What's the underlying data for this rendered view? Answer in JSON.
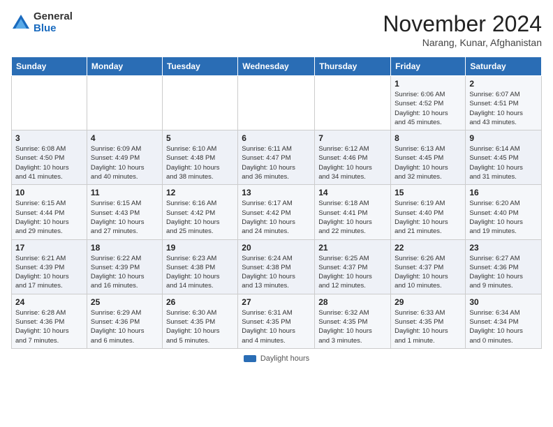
{
  "logo": {
    "general": "General",
    "blue": "Blue"
  },
  "title": "November 2024",
  "location": "Narang, Kunar, Afghanistan",
  "weekdays": [
    "Sunday",
    "Monday",
    "Tuesday",
    "Wednesday",
    "Thursday",
    "Friday",
    "Saturday"
  ],
  "weeks": [
    [
      {
        "day": "",
        "info": ""
      },
      {
        "day": "",
        "info": ""
      },
      {
        "day": "",
        "info": ""
      },
      {
        "day": "",
        "info": ""
      },
      {
        "day": "",
        "info": ""
      },
      {
        "day": "1",
        "info": "Sunrise: 6:06 AM\nSunset: 4:52 PM\nDaylight: 10 hours\nand 45 minutes."
      },
      {
        "day": "2",
        "info": "Sunrise: 6:07 AM\nSunset: 4:51 PM\nDaylight: 10 hours\nand 43 minutes."
      }
    ],
    [
      {
        "day": "3",
        "info": "Sunrise: 6:08 AM\nSunset: 4:50 PM\nDaylight: 10 hours\nand 41 minutes."
      },
      {
        "day": "4",
        "info": "Sunrise: 6:09 AM\nSunset: 4:49 PM\nDaylight: 10 hours\nand 40 minutes."
      },
      {
        "day": "5",
        "info": "Sunrise: 6:10 AM\nSunset: 4:48 PM\nDaylight: 10 hours\nand 38 minutes."
      },
      {
        "day": "6",
        "info": "Sunrise: 6:11 AM\nSunset: 4:47 PM\nDaylight: 10 hours\nand 36 minutes."
      },
      {
        "day": "7",
        "info": "Sunrise: 6:12 AM\nSunset: 4:46 PM\nDaylight: 10 hours\nand 34 minutes."
      },
      {
        "day": "8",
        "info": "Sunrise: 6:13 AM\nSunset: 4:45 PM\nDaylight: 10 hours\nand 32 minutes."
      },
      {
        "day": "9",
        "info": "Sunrise: 6:14 AM\nSunset: 4:45 PM\nDaylight: 10 hours\nand 31 minutes."
      }
    ],
    [
      {
        "day": "10",
        "info": "Sunrise: 6:15 AM\nSunset: 4:44 PM\nDaylight: 10 hours\nand 29 minutes."
      },
      {
        "day": "11",
        "info": "Sunrise: 6:15 AM\nSunset: 4:43 PM\nDaylight: 10 hours\nand 27 minutes."
      },
      {
        "day": "12",
        "info": "Sunrise: 6:16 AM\nSunset: 4:42 PM\nDaylight: 10 hours\nand 25 minutes."
      },
      {
        "day": "13",
        "info": "Sunrise: 6:17 AM\nSunset: 4:42 PM\nDaylight: 10 hours\nand 24 minutes."
      },
      {
        "day": "14",
        "info": "Sunrise: 6:18 AM\nSunset: 4:41 PM\nDaylight: 10 hours\nand 22 minutes."
      },
      {
        "day": "15",
        "info": "Sunrise: 6:19 AM\nSunset: 4:40 PM\nDaylight: 10 hours\nand 21 minutes."
      },
      {
        "day": "16",
        "info": "Sunrise: 6:20 AM\nSunset: 4:40 PM\nDaylight: 10 hours\nand 19 minutes."
      }
    ],
    [
      {
        "day": "17",
        "info": "Sunrise: 6:21 AM\nSunset: 4:39 PM\nDaylight: 10 hours\nand 17 minutes."
      },
      {
        "day": "18",
        "info": "Sunrise: 6:22 AM\nSunset: 4:39 PM\nDaylight: 10 hours\nand 16 minutes."
      },
      {
        "day": "19",
        "info": "Sunrise: 6:23 AM\nSunset: 4:38 PM\nDaylight: 10 hours\nand 14 minutes."
      },
      {
        "day": "20",
        "info": "Sunrise: 6:24 AM\nSunset: 4:38 PM\nDaylight: 10 hours\nand 13 minutes."
      },
      {
        "day": "21",
        "info": "Sunrise: 6:25 AM\nSunset: 4:37 PM\nDaylight: 10 hours\nand 12 minutes."
      },
      {
        "day": "22",
        "info": "Sunrise: 6:26 AM\nSunset: 4:37 PM\nDaylight: 10 hours\nand 10 minutes."
      },
      {
        "day": "23",
        "info": "Sunrise: 6:27 AM\nSunset: 4:36 PM\nDaylight: 10 hours\nand 9 minutes."
      }
    ],
    [
      {
        "day": "24",
        "info": "Sunrise: 6:28 AM\nSunset: 4:36 PM\nDaylight: 10 hours\nand 7 minutes."
      },
      {
        "day": "25",
        "info": "Sunrise: 6:29 AM\nSunset: 4:36 PM\nDaylight: 10 hours\nand 6 minutes."
      },
      {
        "day": "26",
        "info": "Sunrise: 6:30 AM\nSunset: 4:35 PM\nDaylight: 10 hours\nand 5 minutes."
      },
      {
        "day": "27",
        "info": "Sunrise: 6:31 AM\nSunset: 4:35 PM\nDaylight: 10 hours\nand 4 minutes."
      },
      {
        "day": "28",
        "info": "Sunrise: 6:32 AM\nSunset: 4:35 PM\nDaylight: 10 hours\nand 3 minutes."
      },
      {
        "day": "29",
        "info": "Sunrise: 6:33 AM\nSunset: 4:35 PM\nDaylight: 10 hours\nand 1 minute."
      },
      {
        "day": "30",
        "info": "Sunrise: 6:34 AM\nSunset: 4:34 PM\nDaylight: 10 hours\nand 0 minutes."
      }
    ]
  ],
  "footer": {
    "swatch_label": "Daylight hours"
  }
}
